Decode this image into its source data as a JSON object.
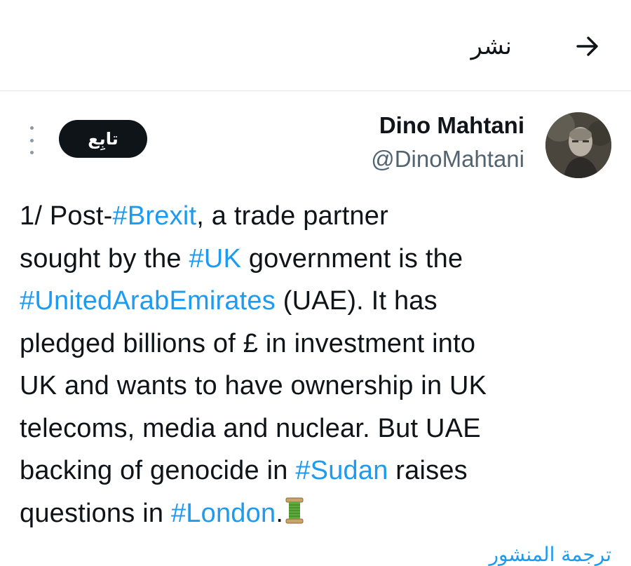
{
  "header": {
    "title": "نشر",
    "back_icon": "arrow-right-icon"
  },
  "tweet": {
    "author_name": "Dino Mahtani",
    "author_handle": "@DinoMahtani",
    "follow_label": "تابِع",
    "more_icon": "vertical-ellipsis-icon",
    "text_segments": {
      "s1": "1/ Post-",
      "h1": "#Brexit",
      "s2": ", a trade partner",
      "s3": "sought by the ",
      "h2": "#UK",
      "s4": " government is the",
      "h3": "#UnitedArabEmirates",
      "s5": " (UAE). It has",
      "s6": "pledged billions of £ in investment into",
      "s7": "UK and wants to have ownership in UK",
      "s8": "telecoms, media and nuclear. But UAE",
      "s9": "backing of genocide in ",
      "h4": "#Sudan",
      "s10": " raises",
      "s11": "questions in ",
      "h5": "#London",
      "s12": "."
    },
    "emoji": "spool-of-thread-icon",
    "translate_label": "ترجمة المنشور"
  },
  "colors": {
    "accent": "#1d9bf0",
    "text": "#0f1419",
    "secondary": "#536471",
    "follow_bg": "#0f1419"
  }
}
